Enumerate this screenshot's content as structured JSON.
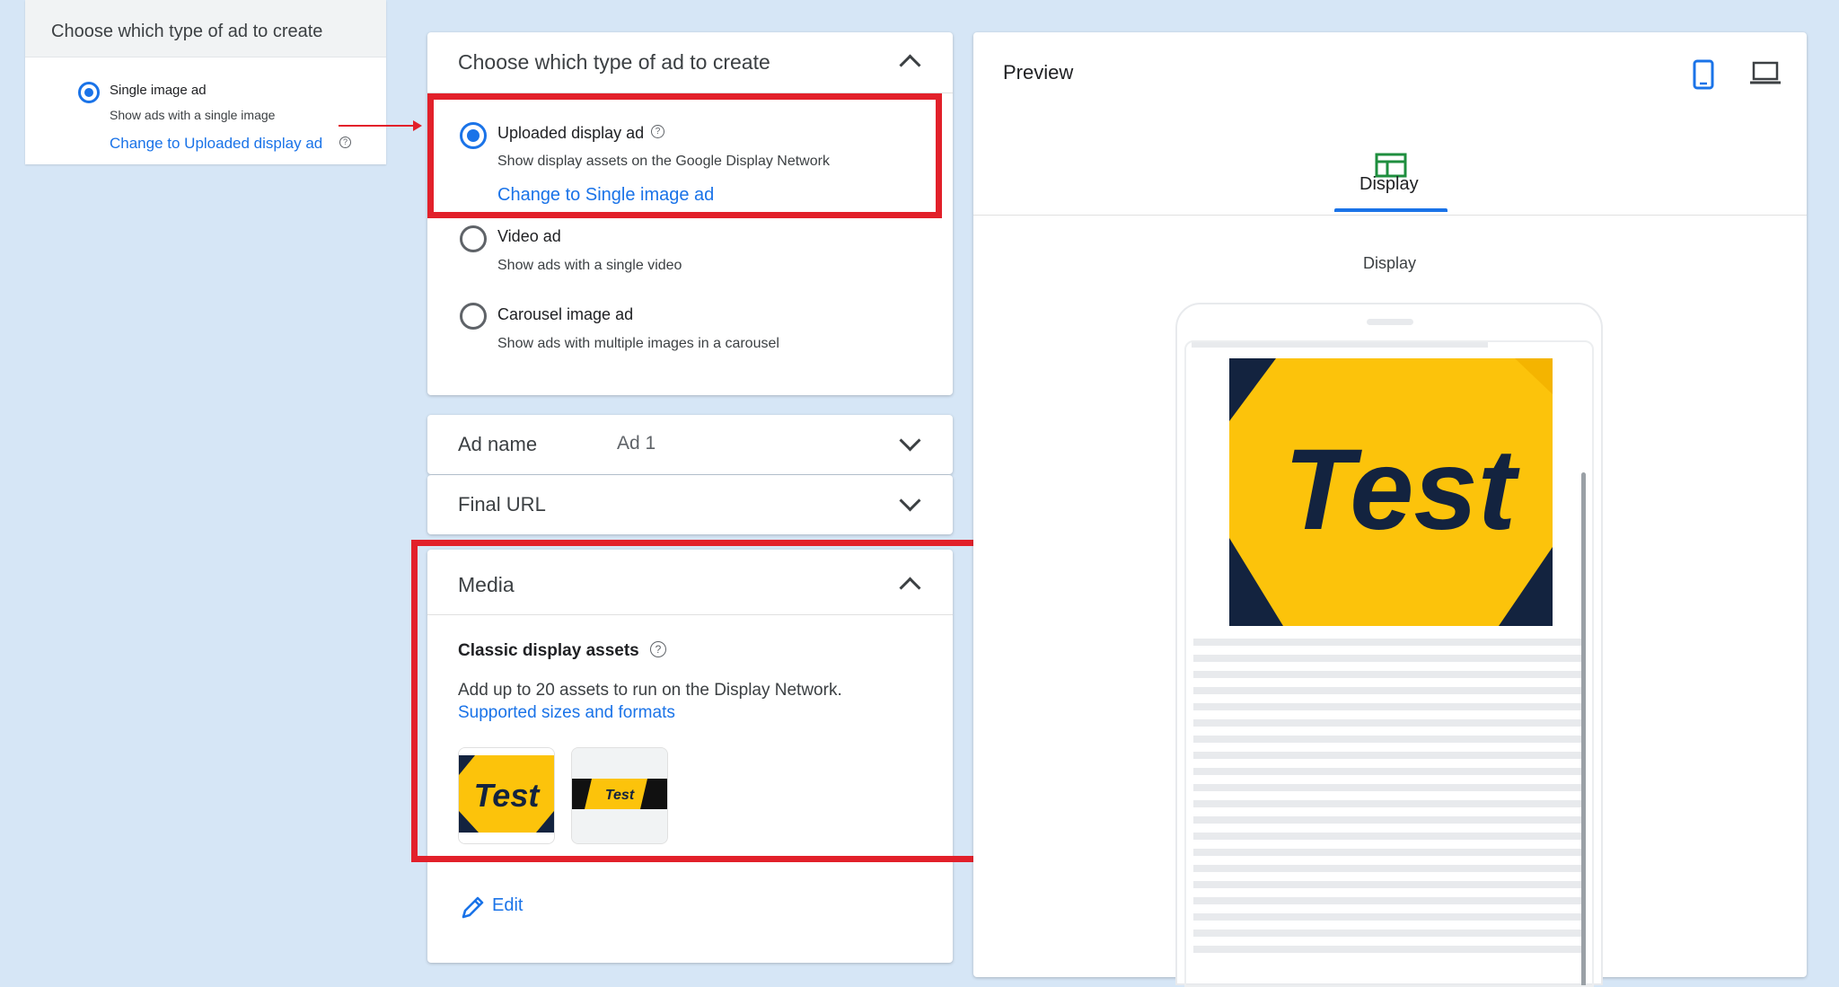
{
  "inset": {
    "header": "Choose which type of ad to create",
    "option_title": "Single image ad",
    "option_subtitle": "Show ads with a single image",
    "change_link": "Change to Uploaded display ad",
    "help_glyph": "?"
  },
  "ad_type": {
    "header": "Choose which type of ad to create",
    "options": [
      {
        "title": "Uploaded display ad",
        "subtitle": "Show display assets on the Google Display Network",
        "link": "Change to Single image ad",
        "selected": true
      },
      {
        "title": "Video ad",
        "subtitle": "Show ads with a single video",
        "selected": false
      },
      {
        "title": "Carousel image ad",
        "subtitle": "Show ads with multiple images in a carousel",
        "selected": false
      }
    ],
    "help_glyph": "?"
  },
  "ad_name": {
    "label": "Ad name",
    "value": "Ad 1"
  },
  "final_url": {
    "label": "Final URL"
  },
  "media": {
    "header": "Media",
    "assets_title": "Classic display assets",
    "help_glyph": "?",
    "description": "Add up to 20 assets to run on the Display Network.",
    "link": "Supported sizes and formats",
    "thumbnails": [
      {
        "text": "Test"
      },
      {
        "text": "Test"
      }
    ],
    "edit_label": "Edit"
  },
  "preview": {
    "title": "Preview",
    "tab_label": "Display",
    "caption": "Display",
    "ad_text": "Test"
  },
  "colors": {
    "accent": "#1a73e8",
    "highlight": "#e2202a",
    "ad_yellow": "#fcc30b",
    "ad_navy": "#13233f",
    "display_icon": "#1e8e3e"
  },
  "icons": [
    "mobile-device-icon",
    "desktop-icon",
    "display-layout-icon",
    "pencil-icon",
    "chevron-up-icon",
    "chevron-down-icon",
    "help-icon"
  ]
}
